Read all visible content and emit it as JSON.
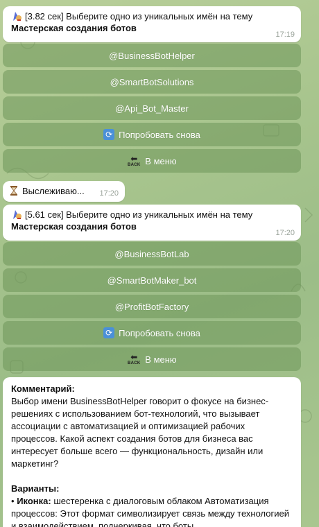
{
  "messages": [
    {
      "prefix": "[3.82 сек] Выберите одно из уникальных имён на тему",
      "topic": "Мастерская создания ботов",
      "time": "17:19",
      "buttons": [
        "@BusinessBotHelper",
        "@SmartBotSolutions",
        "@Api_Bot_Master"
      ],
      "retry_label": "Попробовать снова",
      "menu_label": "В меню"
    },
    {
      "prefix": "[5.61 сек] Выберите одно из уникальных имён на тему",
      "topic": "Мастерская создания ботов",
      "time": "17:20",
      "buttons": [
        "@BusinessBotLab",
        "@SmartBotMaker_bot",
        "@ProfitBotFactory"
      ],
      "retry_label": "Попробовать снова",
      "menu_label": "В меню"
    }
  ],
  "tracking": {
    "text": "Выслеживаю...",
    "time": "17:20"
  },
  "comment": {
    "heading": "Комментарий:",
    "body": "Выбор имени BusinessBotHelper говорит о фокусе на бизнес-решениях с использованием бот-технологий, что вызывает ассоциации с автоматизацией и оптимизацией рабочих процессов. Какой аспект создания ботов для бизнеса вас интересует больше всего — функциональность, дизайн или маркетинг?",
    "variants_heading": "Варианты:",
    "bullet": "•",
    "variant_label": "Иконка:",
    "variant_text": "шестеренка с диалоговым облаком Автоматизация процессов: Этот формат символизирует связь между технологией и взаимодействием, подчеркивая, что боты"
  },
  "colors": {
    "button_bg": "#6e965a",
    "bubble_bg": "#ffffff",
    "retry_icon": "#4a90d9"
  },
  "icons": {
    "message_emoji": "mage-icon",
    "hourglass": "hourglass-icon",
    "retry": "retry-icon",
    "back": "back-arrow-icon"
  }
}
